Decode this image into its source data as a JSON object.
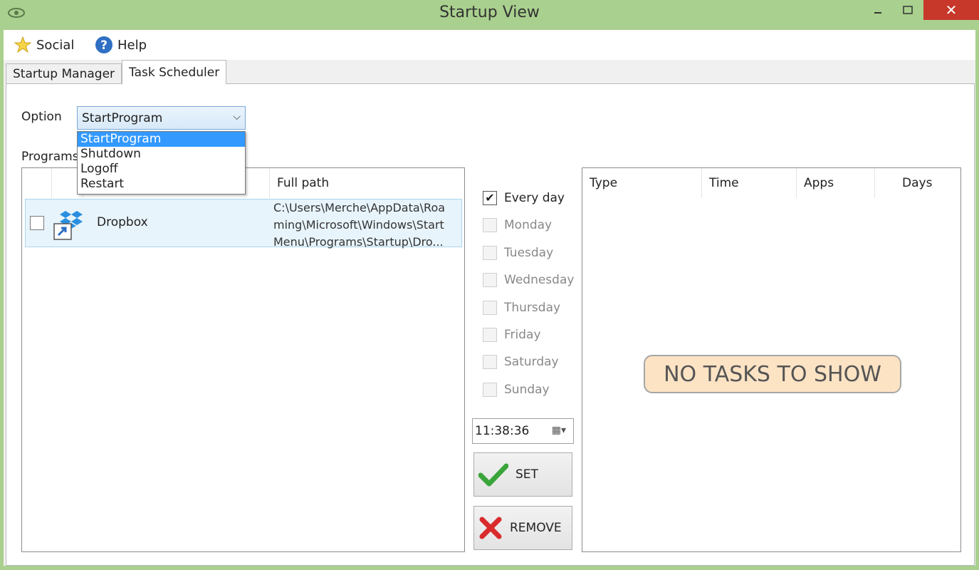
{
  "window": {
    "title": "Startup View"
  },
  "menu": {
    "social": "Social",
    "help": "Help"
  },
  "tabs": [
    {
      "label": "Startup Manager"
    },
    {
      "label": "Task Scheduler"
    }
  ],
  "option": {
    "label": "Option",
    "selected": "StartProgram",
    "options": [
      "StartProgram",
      "Shutdown",
      "Logoff",
      "Restart"
    ]
  },
  "programs": {
    "label": "Programs",
    "full_path_header": "Full path",
    "rows": [
      {
        "name": "Dropbox",
        "path_lines": [
          "C:\\Users\\Merche\\AppData\\Roa",
          "ming\\Microsoft\\Windows\\Start",
          "Menu\\Programs\\Startup\\Dro..."
        ]
      }
    ]
  },
  "days": [
    {
      "label": "Every day",
      "checked": true
    },
    {
      "label": "Monday",
      "checked": false
    },
    {
      "label": "Tuesday",
      "checked": false
    },
    {
      "label": "Wednesday",
      "checked": false
    },
    {
      "label": "Thursday",
      "checked": false
    },
    {
      "label": "Friday",
      "checked": false
    },
    {
      "label": "Saturday",
      "checked": false
    },
    {
      "label": "Sunday",
      "checked": false
    }
  ],
  "time": "11:38:36",
  "buttons": {
    "set": "SET",
    "remove": "REMOVE"
  },
  "tasks": {
    "headers": {
      "type": "Type",
      "time": "Time",
      "apps": "Apps",
      "days": "Days"
    },
    "empty_message": "NO TASKS TO SHOW"
  },
  "icons": {
    "app": "eye-icon",
    "social": "star-icon",
    "help": "help-icon",
    "program": "dropbox-icon",
    "set": "checkmark-icon",
    "remove": "x-icon",
    "time_picker": "calendar-icon"
  },
  "colors": {
    "frame": "#a9d08e",
    "selection": "#3399ff",
    "close": "#c7382b",
    "empty_badge": "#fce3c4"
  }
}
